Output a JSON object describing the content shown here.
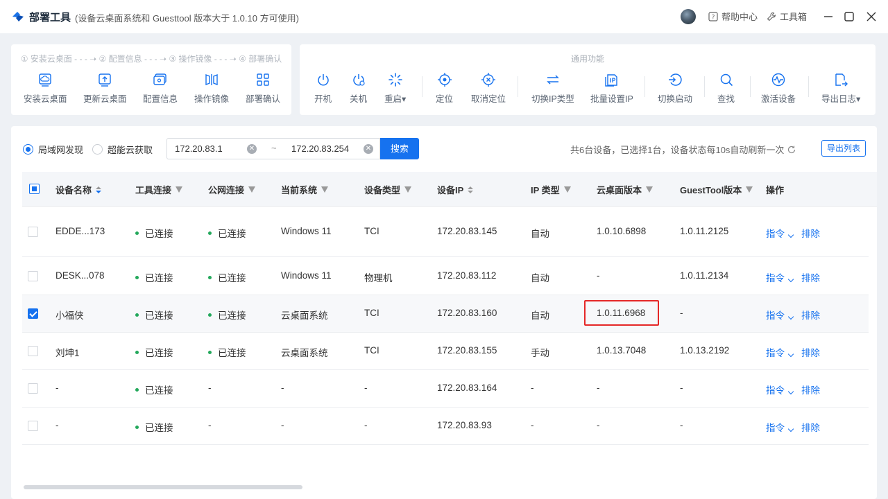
{
  "app": {
    "title": "部署工具",
    "subtitle": "(设备云桌面系统和 Guesttool 版本大于 1.0.10 方可使用)",
    "help": "帮助中心",
    "toolbox": "工具箱"
  },
  "steps": {
    "flow": "① 安装云桌面 - - - ➝ ② 配置信息 - - - ➝ ③ 操作镜像 - - - ➝ ④ 部署确认",
    "items": [
      {
        "label": "安装云桌面",
        "icon": "cloud-install-icon"
      },
      {
        "label": "更新云桌面",
        "icon": "cloud-upload-icon"
      },
      {
        "label": "配置信息",
        "icon": "monitor-config-icon"
      },
      {
        "label": "操作镜像",
        "icon": "mirror-icon"
      },
      {
        "label": "部署确认",
        "icon": "deploy-confirm-icon"
      }
    ]
  },
  "functions": {
    "title": "通用功能",
    "items": [
      {
        "label": "开机",
        "icon": "power-on-icon"
      },
      {
        "label": "关机",
        "icon": "power-off-icon"
      },
      {
        "label": "重启▾",
        "icon": "restart-icon"
      },
      {
        "label": "定位",
        "icon": "locate-icon"
      },
      {
        "label": "取消定位",
        "icon": "cancel-locate-icon"
      },
      {
        "label": "切换IP类型",
        "icon": "switch-ip-icon"
      },
      {
        "label": "批量设置IP",
        "icon": "batch-ip-icon"
      },
      {
        "label": "切换启动",
        "icon": "switch-boot-icon"
      },
      {
        "label": "查找",
        "icon": "search-icon"
      },
      {
        "label": "激活设备",
        "icon": "activate-icon"
      },
      {
        "label": "导出日志▾",
        "icon": "export-log-icon"
      }
    ]
  },
  "discovery": {
    "lan": "局域网发现",
    "cloud": "超能云获取",
    "ip_start": "172.20.83.1",
    "ip_end": "172.20.83.254",
    "tilde": "~",
    "search": "搜索",
    "summary": "共6台设备，已选择1台，设备状态每10s自动刷新一次",
    "export_list": "导出列表"
  },
  "table": {
    "headers": {
      "name": "设备名称",
      "tool": "工具连接",
      "public": "公网连接",
      "system": "当前系统",
      "type": "设备类型",
      "ip": "设备IP",
      "iptype": "IP 类型",
      "cdver": "云桌面版本",
      "gtver": "GuestTool版本",
      "ops": "操作"
    },
    "op_cmd": "指令",
    "op_remove": "排除",
    "rows": [
      {
        "name": "EDDE...173",
        "tool": "已连接",
        "public": "已连接",
        "system": "Windows 11",
        "type": "TCI",
        "ip": "172.20.83.145",
        "iptype": "自动",
        "cdver": "1.0.10.6898",
        "gtver": "1.0.11.2125",
        "checked": false
      },
      {
        "name": "DESK...078",
        "tool": "已连接",
        "public": "已连接",
        "system": "Windows 11",
        "type": "物理机",
        "ip": "172.20.83.112",
        "iptype": "自动",
        "cdver": "-",
        "gtver": "1.0.11.2134",
        "checked": false
      },
      {
        "name": "小福侠",
        "tool": "已连接",
        "public": "已连接",
        "system": "云桌面系统",
        "type": "TCI",
        "ip": "172.20.83.160",
        "iptype": "自动",
        "cdver": "1.0.11.6968",
        "gtver": "-",
        "checked": true
      },
      {
        "name": "刘坤1",
        "tool": "已连接",
        "public": "已连接",
        "system": "云桌面系统",
        "type": "TCI",
        "ip": "172.20.83.155",
        "iptype": "手动",
        "cdver": "1.0.13.7048",
        "gtver": "1.0.13.2192",
        "checked": false
      },
      {
        "name": "-",
        "tool": "已连接",
        "public": "-",
        "system": "-",
        "type": "-",
        "ip": "172.20.83.164",
        "iptype": "-",
        "cdver": "-",
        "gtver": "-",
        "checked": false
      },
      {
        "name": "-",
        "tool": "已连接",
        "public": "-",
        "system": "-",
        "type": "-",
        "ip": "172.20.83.93",
        "iptype": "-",
        "cdver": "-",
        "gtver": "-",
        "checked": false
      }
    ]
  },
  "colors": {
    "accent": "#1672ef",
    "connected": "#23a85b",
    "highlight": "#e52727"
  }
}
